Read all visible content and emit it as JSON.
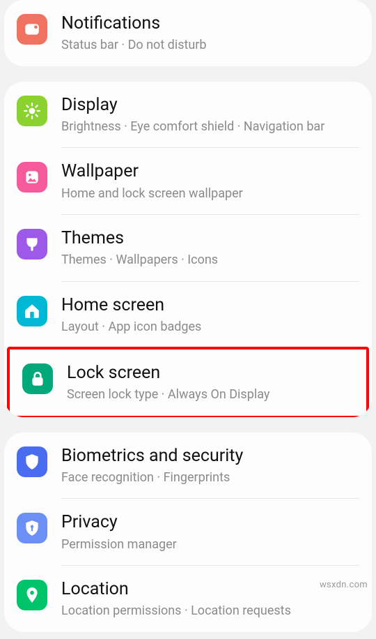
{
  "watermark": "wsxdn.com",
  "groups": [
    {
      "items": [
        {
          "id": "notifications",
          "title": "Notifications",
          "subtitle": "Status bar  ·  Do not disturb",
          "icon": "notifications-icon",
          "color": "#f07362"
        }
      ]
    },
    {
      "items": [
        {
          "id": "display",
          "title": "Display",
          "subtitle": "Brightness  ·  Eye comfort shield  ·  Navigation bar",
          "icon": "display-icon",
          "color": "#8bd12f"
        },
        {
          "id": "wallpaper",
          "title": "Wallpaper",
          "subtitle": "Home and lock screen wallpaper",
          "icon": "wallpaper-icon",
          "color": "#f55a9b"
        },
        {
          "id": "themes",
          "title": "Themes",
          "subtitle": "Themes  ·  Wallpapers  ·  Icons",
          "icon": "themes-icon",
          "color": "#9d5ae8"
        },
        {
          "id": "homescreen",
          "title": "Home screen",
          "subtitle": "Layout  ·  App icon badges",
          "icon": "home-icon",
          "color": "#00b8d4"
        },
        {
          "id": "lockscreen",
          "title": "Lock screen",
          "subtitle": "Screen lock type  ·  Always On Display",
          "icon": "lock-icon",
          "color": "#00a87a",
          "highlighted": true
        }
      ]
    },
    {
      "items": [
        {
          "id": "biometrics",
          "title": "Biometrics and security",
          "subtitle": "Face recognition  ·  Fingerprints",
          "icon": "shield-icon",
          "color": "#4a6cf0"
        },
        {
          "id": "privacy",
          "title": "Privacy",
          "subtitle": "Permission manager",
          "icon": "privacy-icon",
          "color": "#6b8ff5"
        },
        {
          "id": "location",
          "title": "Location",
          "subtitle": "Location permissions  ·  Location requests",
          "icon": "location-icon",
          "color": "#00c46a"
        }
      ]
    }
  ]
}
